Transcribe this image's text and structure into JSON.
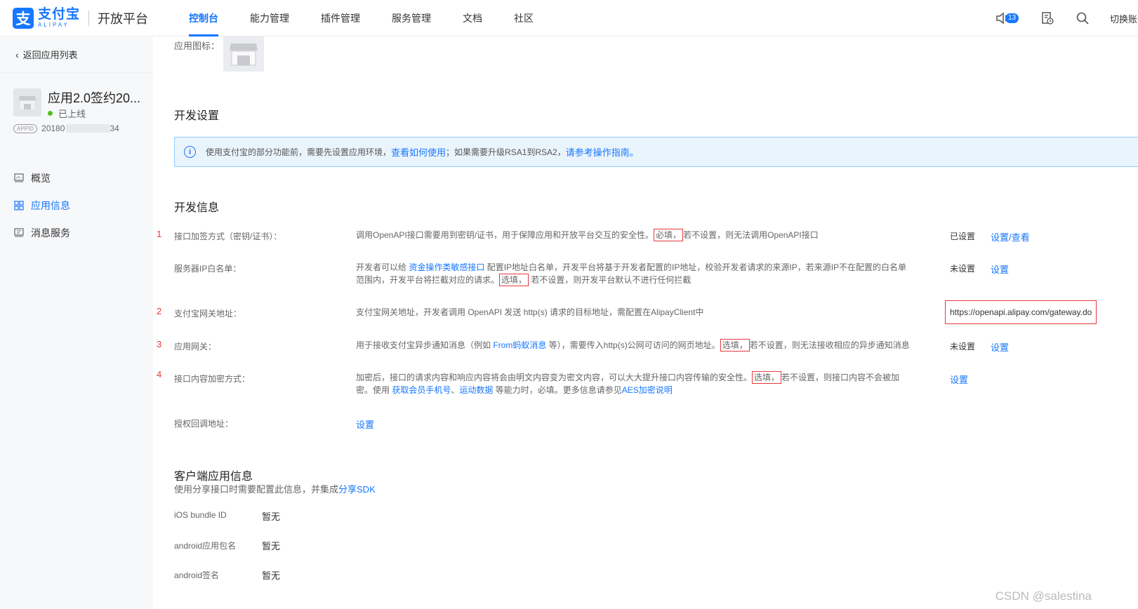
{
  "brand": {
    "logo_glyph": "支",
    "logo_cn": "支付宝",
    "logo_en": "ALIPAY",
    "platform": "开放平台",
    "color": "#1677ff"
  },
  "nav": {
    "items": [
      "控制台",
      "能力管理",
      "插件管理",
      "服务管理",
      "文档",
      "社区"
    ],
    "active_index": 0
  },
  "toolbar": {
    "notification_count": "13",
    "switch_label": "切换账号"
  },
  "sidebar": {
    "back_label": "返回应用列表",
    "app_name": "应用2.0签约20...",
    "app_status": "已上线",
    "appid_tag": "APPID",
    "appid_prefix": "20180",
    "appid_suffix": "34",
    "menu": [
      {
        "label": "概览",
        "icon": "dashboard-icon"
      },
      {
        "label": "应用信息",
        "icon": "grid-icon"
      },
      {
        "label": "消息服务",
        "icon": "message-icon"
      }
    ],
    "active_menu_index": 1
  },
  "main": {
    "app_icon_label": "应用图标：",
    "dev_settings_title": "开发设置",
    "notice": {
      "text1": "使用支付宝的部分功能前，需要先设置应用环境，",
      "link1": "查看如何使用",
      "text2": "；如果需要升级RSA1到RSA2，",
      "link2": "请参考操作指南。"
    },
    "dev_info_title": "开发信息",
    "rows": {
      "sign": {
        "num": "1",
        "label": "接口加签方式（密钥/证书）：",
        "desc1": "调用OpenAPI接口需要用到密钥/证书，用于保障应用和开放平台交互的安全性。",
        "mark": "必填，",
        "desc2": "若不设置，则无法调用OpenAPI接口",
        "status": "已设置",
        "action": "设置/查看"
      },
      "ip": {
        "label": "服务器IP白名单：",
        "desc1": "开发者可以给 ",
        "link": "资金操作类敏感接口",
        "desc2": " 配置IP地址白名单，开发平台将基于开发者配置的IP地址，校验开发者请求的来源IP，若来源IP不在配置的白名单范围内，开发平台将拦截对应的请求。",
        "mark": "选填，",
        "desc3": " 若不设置，则开发平台默认不进行任何拦截",
        "status": "未设置",
        "action": "设置"
      },
      "gateway": {
        "num": "2",
        "label": "支付宝网关地址：",
        "desc": "支付宝网关地址，开发者调用 OpenAPI 发送 http(s) 请求的目标地址，需配置在AlipayClient中",
        "value": "https://openapi.alipay.com/gateway.do"
      },
      "app_gateway": {
        "num": "3",
        "label": "应用网关：",
        "desc1": "用于接收支付宝异步通知消息（例如 ",
        "link": "From蚂蚁消息",
        "desc2": " 等），需要传入http(s)公网可访问的网页地址。",
        "mark": "选填，",
        "desc3": "若不设置，则无法接收相应的异步通知消息",
        "status": "未设置",
        "action": "设置"
      },
      "encrypt": {
        "num": "4",
        "label": "接口内容加密方式：",
        "desc1": "加密后，接口的请求内容和响应内容将会由明文内容变为密文内容，可以大大提升接口内容传输的安全性。",
        "mark": "选填，",
        "desc2": "若不设置，则接口内容不会被加密。使用 ",
        "link1": "获取会员手机号",
        "sep": "、",
        "link2": "运动数据",
        "desc3": " 等能力时，必填。更多信息请参见",
        "link3": "AES加密说明",
        "action": "设置"
      },
      "callback": {
        "label": "授权回调地址：",
        "action": "设置"
      }
    },
    "client_title": "客户端应用信息",
    "client_desc": "使用分享接口时需要配置此信息，并集成",
    "client_link": "分享SDK",
    "client_rows": [
      {
        "label": "iOS bundle ID",
        "value": "暂无"
      },
      {
        "label": "android应用包名",
        "value": "暂无"
      },
      {
        "label": "android签名",
        "value": "暂无"
      }
    ]
  },
  "watermark": "CSDN @salestina"
}
